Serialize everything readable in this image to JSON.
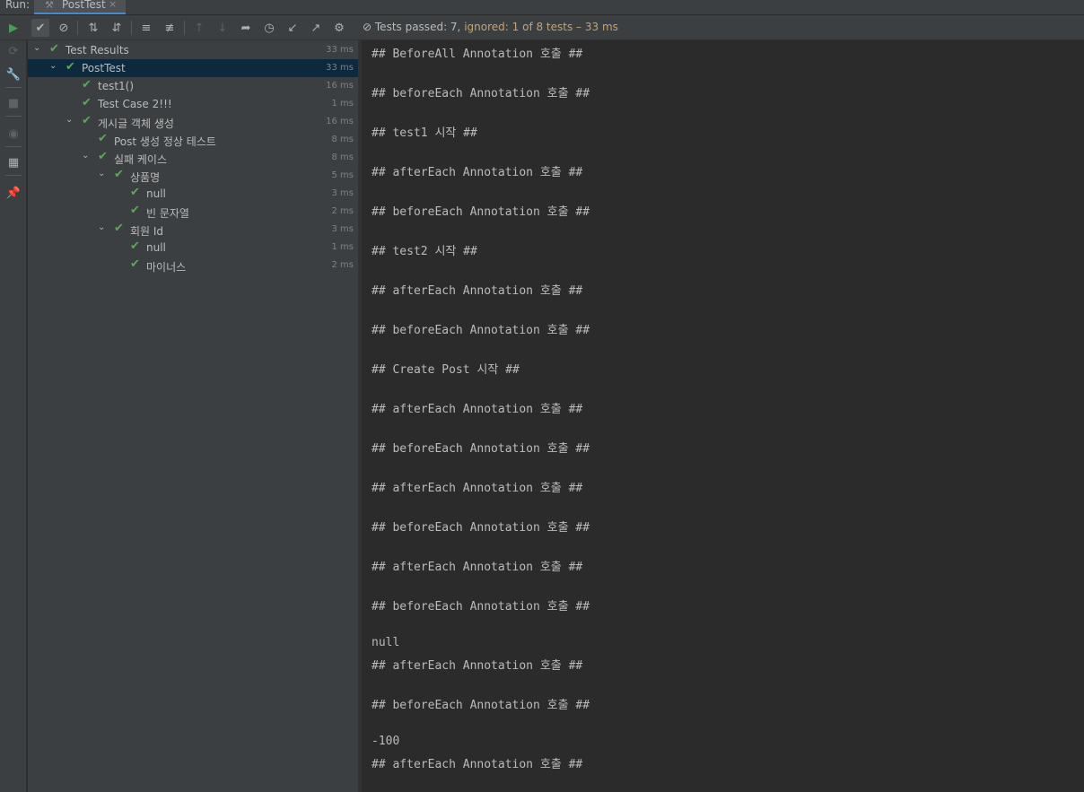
{
  "topbar": {
    "run_label": "Run:",
    "tab_title": "PostTest",
    "tab_close": "×",
    "tab_icon": "test-run-icon"
  },
  "toolbar": {
    "status_passed": "Tests passed: 7,",
    "status_ignored": "ignored:",
    "status_rest": "1 of 8 tests – 33 ms"
  },
  "tree": {
    "rows": [
      {
        "label": "Test Results",
        "time": "33 ms"
      },
      {
        "label": "PostTest",
        "time": "33 ms"
      },
      {
        "label": "test1()",
        "time": "16 ms"
      },
      {
        "label": "Test Case 2!!!",
        "time": "1 ms"
      },
      {
        "label": "게시글 객체 생성",
        "time": "16 ms"
      },
      {
        "label": "Post 생성 정상 테스트",
        "time": "8 ms"
      },
      {
        "label": "실패 케이스",
        "time": "8 ms"
      },
      {
        "label": "상품명",
        "time": "5 ms"
      },
      {
        "label": "null",
        "time": "3 ms"
      },
      {
        "label": "빈 문자열",
        "time": "2 ms"
      },
      {
        "label": "회원 Id",
        "time": "3 ms"
      },
      {
        "label": "null",
        "time": "1 ms"
      },
      {
        "label": "마이너스",
        "time": "2 ms"
      }
    ]
  },
  "console": {
    "lines": [
      "## BeforeAll Annotation 호출 ##",
      "## beforeEach Annotation 호출 ##",
      "## test1 시작 ##",
      "## afterEach Annotation 호출 ##",
      "## beforeEach Annotation 호출 ##",
      "## test2 시작 ##",
      "## afterEach Annotation 호출 ##",
      "## beforeEach Annotation 호출 ##",
      "## Create Post 시작 ##",
      "## afterEach Annotation 호출 ##",
      "## beforeEach Annotation 호출 ##",
      "## afterEach Annotation 호출 ##",
      "## beforeEach Annotation 호출 ##",
      "## afterEach Annotation 호출 ##",
      "## beforeEach Annotation 호출 ##",
      "null",
      "## afterEach Annotation 호출 ##",
      "## beforeEach Annotation 호출 ##",
      "-100",
      "## afterEach Annotation 호출 ##"
    ]
  },
  "colors": {
    "pass_green": "#5fa65b",
    "ignored_orange": "#c9a26d",
    "selection": "#0d293e"
  }
}
